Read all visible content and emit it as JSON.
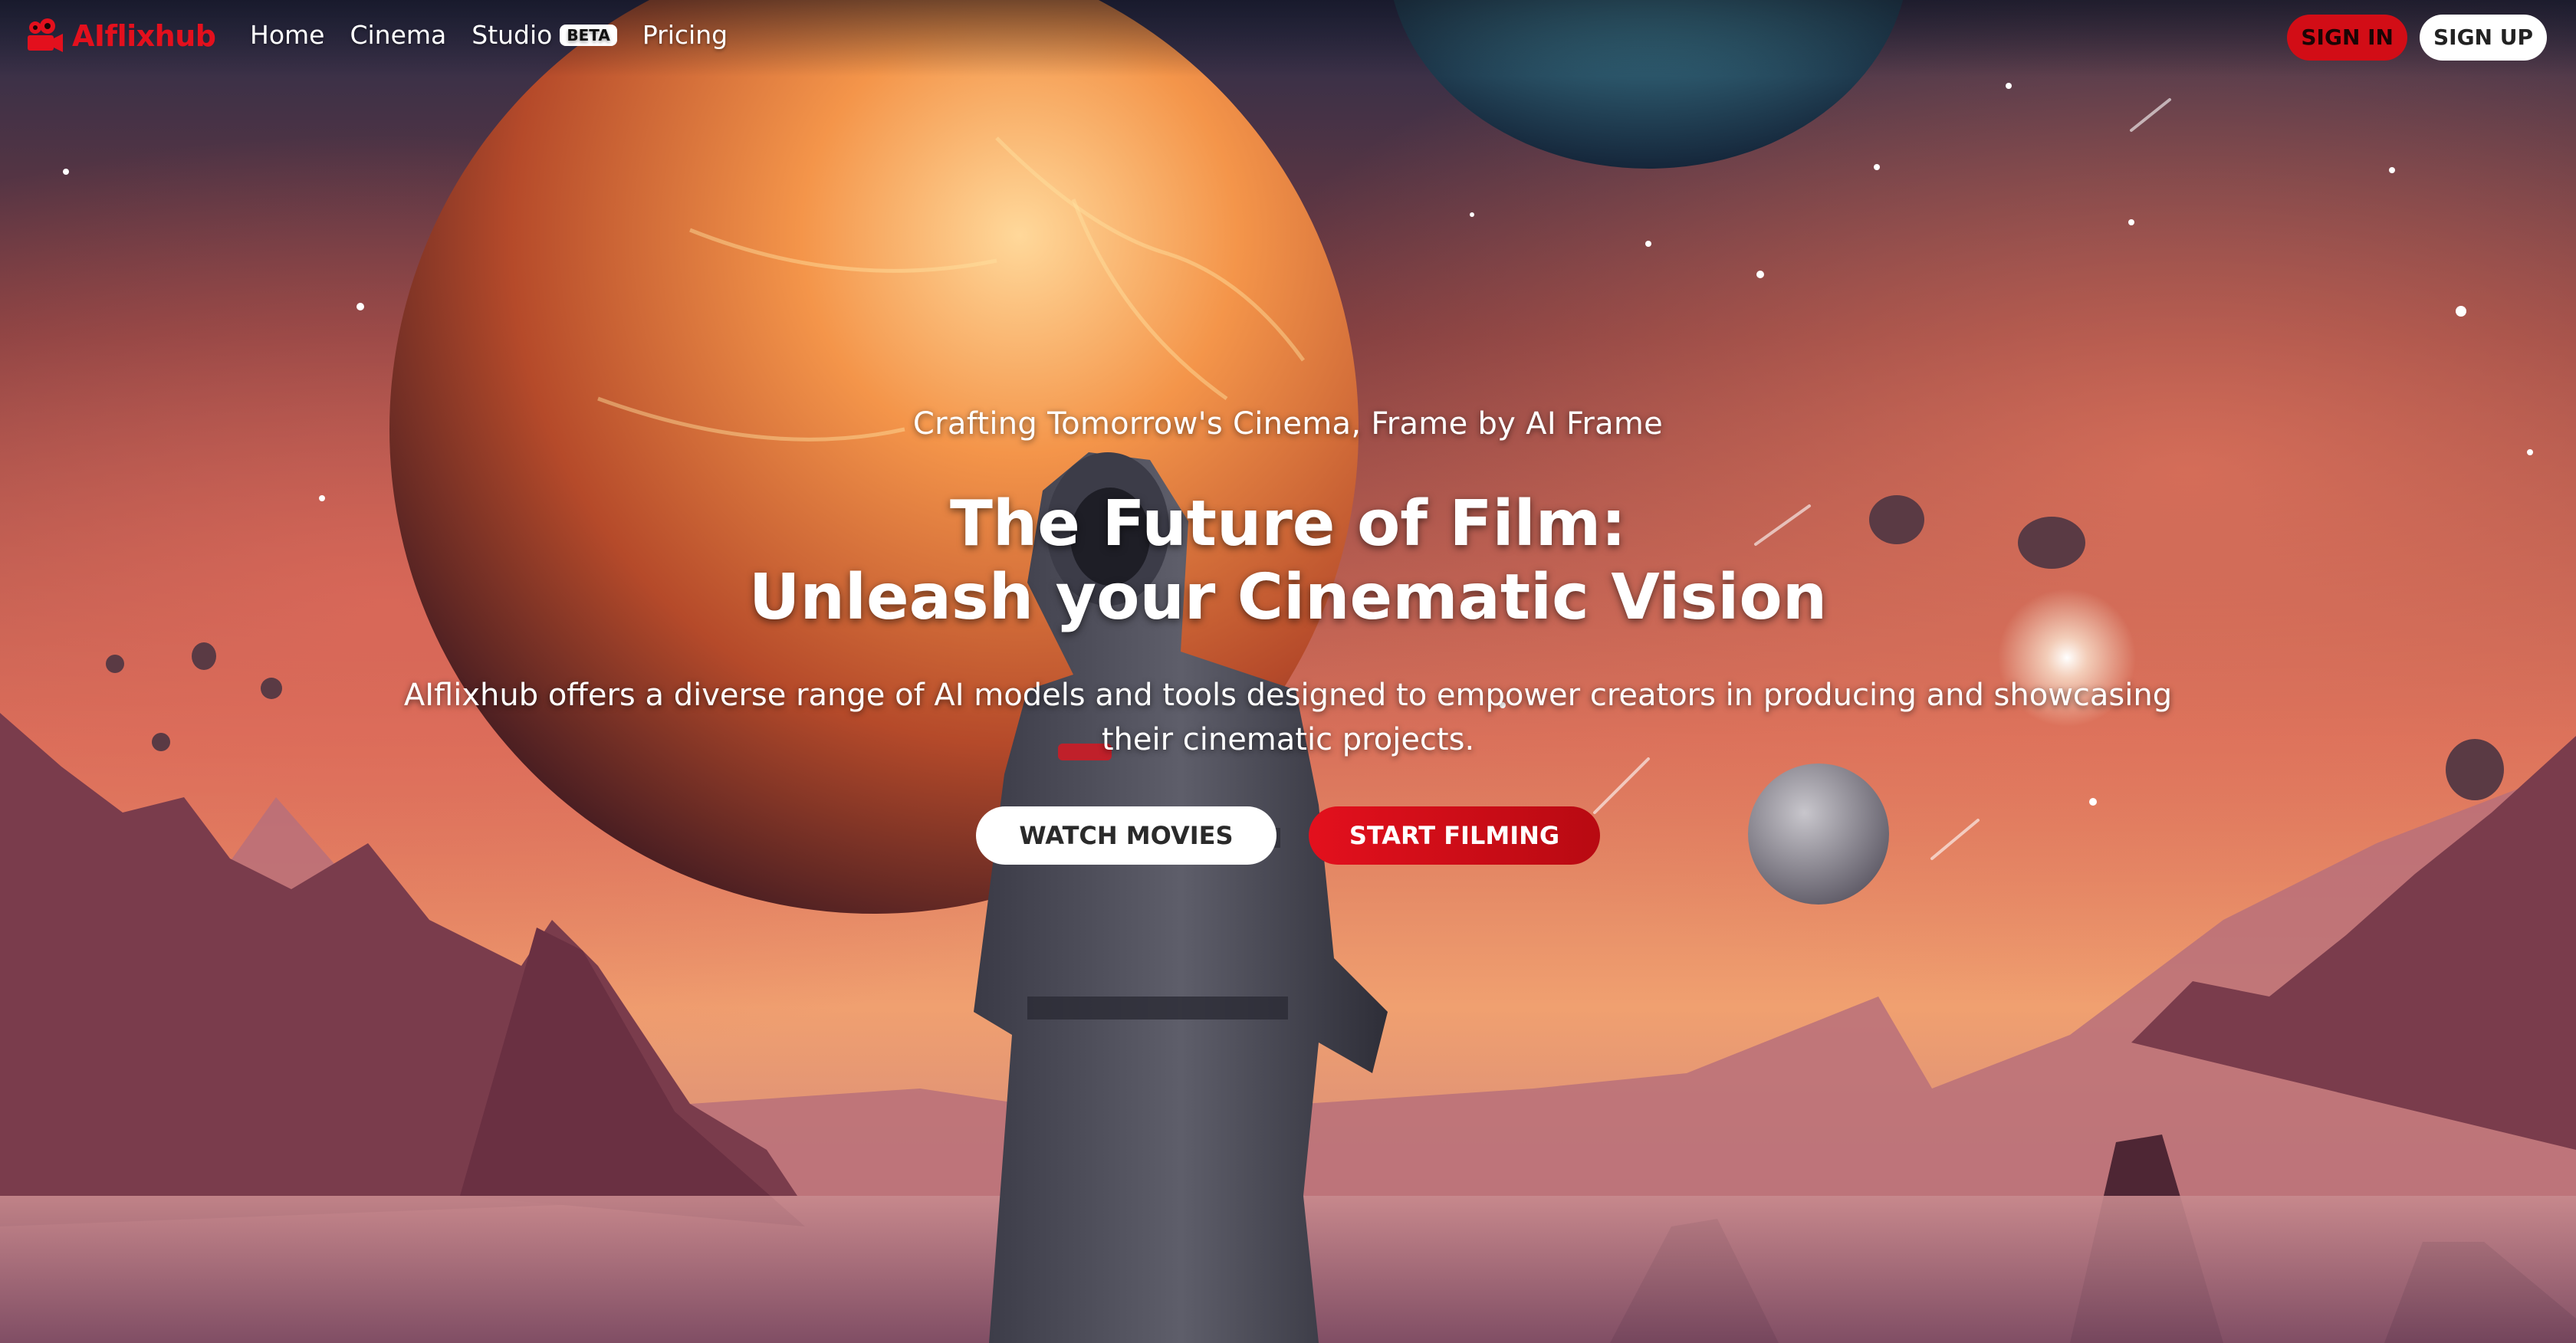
{
  "brand": {
    "name": "AIflixhub",
    "color": "#e3101d"
  },
  "nav": {
    "items": [
      {
        "label": "Home"
      },
      {
        "label": "Cinema"
      },
      {
        "label": "Studio",
        "badge": "BETA"
      },
      {
        "label": "Pricing"
      }
    ]
  },
  "auth": {
    "sign_in": "SIGN IN",
    "sign_up": "SIGN UP"
  },
  "hero": {
    "tagline": "Crafting Tomorrow's Cinema, Frame by AI Frame",
    "headline_line1": "The Future of Film:",
    "headline_line2": "Unleash your Cinematic Vision",
    "description": "AIflixhub offers a diverse range of AI models and tools designed to empower creators in producing and showcasing their cinematic projects.",
    "buttons": {
      "watch": "WATCH MOVIES",
      "film": "START FILMING"
    },
    "background": "astronaut-on-alien-planet-illustration"
  },
  "colors": {
    "accent": "#e3101d",
    "button_light": "#ffffff"
  }
}
